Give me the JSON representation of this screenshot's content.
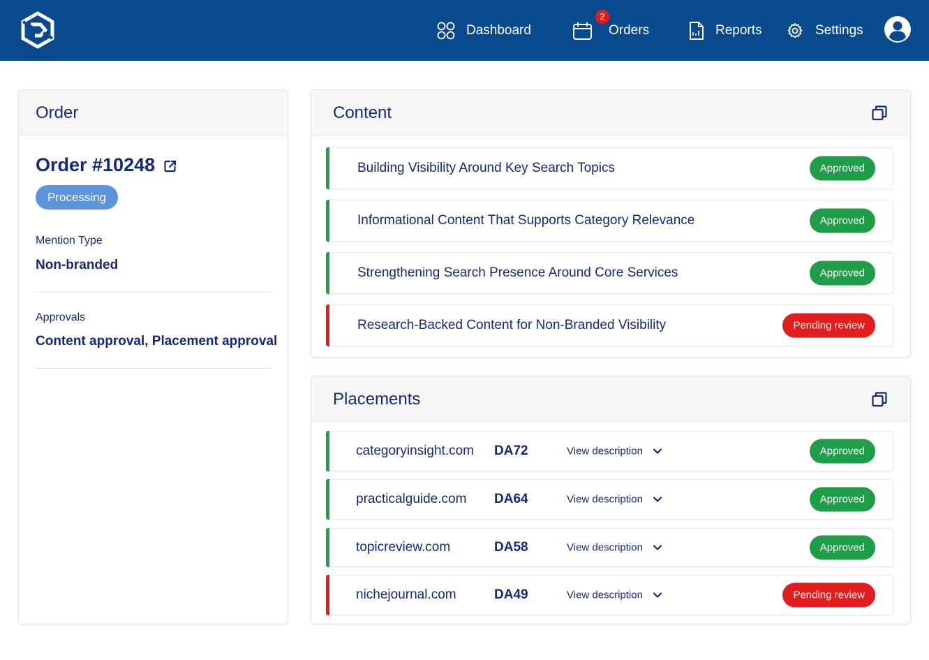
{
  "nav": {
    "items": [
      {
        "label": "Dashboard",
        "icon": "grid-icon"
      },
      {
        "label": "Orders",
        "icon": "calendar-icon",
        "badge": "2"
      },
      {
        "label": "Reports",
        "icon": "report-icon"
      },
      {
        "label": "Settings",
        "icon": "gear-icon"
      }
    ]
  },
  "order": {
    "card_title": "Order",
    "number": "Order #10248",
    "status": "Processing",
    "mention_type_label": "Mention Type",
    "mention_type_value": "Non-branded",
    "approvals_label": "Approvals",
    "approvals_value": "Content approval, Placement approval"
  },
  "content": {
    "card_title": "Content",
    "items": [
      {
        "title": "Building Visibility Around Key Search Topics",
        "status": "Approved"
      },
      {
        "title": "Informational Content That Supports Category Relevance",
        "status": "Approved"
      },
      {
        "title": "Strengthening Search Presence Around Core Services",
        "status": "Approved"
      },
      {
        "title": "Research-Backed Content for Non-Branded Visibility",
        "status": "Pending review"
      }
    ]
  },
  "placements": {
    "card_title": "Placements",
    "items": [
      {
        "domain": "categoryinsight.com",
        "da": "DA72",
        "view": "View description",
        "status": "Approved"
      },
      {
        "domain": "practicalguide.com",
        "da": "DA64",
        "view": "View description",
        "status": "Approved"
      },
      {
        "domain": "topicreview.com",
        "da": "DA58",
        "view": "View description",
        "status": "Approved"
      },
      {
        "domain": "nichejournal.com",
        "da": "DA49",
        "view": "View description",
        "status": "Pending review"
      }
    ]
  },
  "colors": {
    "topbar": "#084a8d",
    "text": "#14297a",
    "approved": "#1f9d49",
    "pending": "#e21d1d",
    "processing": "#5d95dd"
  }
}
